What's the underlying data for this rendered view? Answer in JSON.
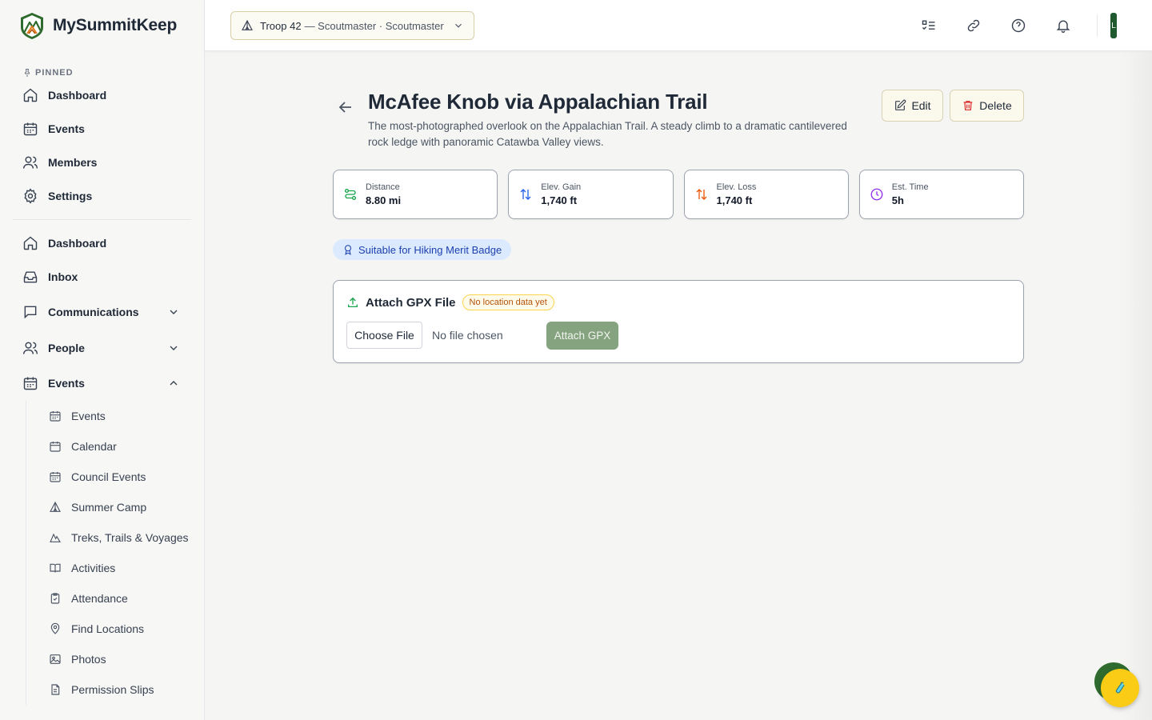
{
  "brand": {
    "name": "MySummitKeep"
  },
  "sidebar": {
    "pinned_label": "PINNED",
    "pinned": [
      {
        "label": "Dashboard",
        "icon": "home-icon"
      },
      {
        "label": "Events",
        "icon": "calendar-icon"
      },
      {
        "label": "Members",
        "icon": "users-icon"
      },
      {
        "label": "Settings",
        "icon": "gear-icon"
      }
    ],
    "main": [
      {
        "label": "Dashboard",
        "icon": "home-icon"
      },
      {
        "label": "Inbox",
        "icon": "inbox-icon"
      },
      {
        "label": "Communications",
        "icon": "chat-icon",
        "expanded": false
      },
      {
        "label": "People",
        "icon": "users-icon",
        "expanded": false
      },
      {
        "label": "Events",
        "icon": "calendar-icon",
        "expanded": true
      }
    ],
    "events_sub": [
      {
        "label": "Events",
        "icon": "calendar-icon"
      },
      {
        "label": "Calendar",
        "icon": "calendar-icon"
      },
      {
        "label": "Council Events",
        "icon": "calendar-icon"
      },
      {
        "label": "Summer Camp",
        "icon": "tent-icon"
      },
      {
        "label": "Treks, Trails & Voyages",
        "icon": "mountain-icon"
      },
      {
        "label": "Activities",
        "icon": "book-icon"
      },
      {
        "label": "Attendance",
        "icon": "clipboard-icon"
      },
      {
        "label": "Find Locations",
        "icon": "map-pin-icon"
      },
      {
        "label": "Photos",
        "icon": "image-icon"
      },
      {
        "label": "Permission Slips",
        "icon": "document-icon"
      }
    ]
  },
  "topbar": {
    "troop_name": "Troop 42",
    "troop_role": "— Scoutmaster · Scoutmaster",
    "avatar_initial": "L"
  },
  "trail": {
    "title": "McAfee Knob via Appalachian Trail",
    "description": "The most-photographed overlook on the Appalachian Trail. A steady climb to a dramatic cantilevered rock ledge with panoramic Catawba Valley views.",
    "edit_label": "Edit",
    "delete_label": "Delete",
    "stats": [
      {
        "label": "Distance",
        "value": "8.80 mi",
        "icon": "route-icon",
        "color": "#16a34a"
      },
      {
        "label": "Elev. Gain",
        "value": "1,740 ft",
        "icon": "arrows-up-down-icon",
        "color": "#2563eb"
      },
      {
        "label": "Elev. Loss",
        "value": "1,740 ft",
        "icon": "arrows-up-down-icon",
        "color": "#ea580c"
      },
      {
        "label": "Est. Time",
        "value": "5h",
        "icon": "clock-icon",
        "color": "#9333ea"
      }
    ],
    "badge": "Suitable for Hiking Merit Badge"
  },
  "gpx": {
    "title": "Attach GPX File",
    "status_pill": "No location data yet",
    "choose_label": "Choose File",
    "file_status": "No file chosen",
    "attach_label": "Attach GPX"
  },
  "colors": {
    "accent_green": "#2f6b2f",
    "fab_yellow": "#facc15",
    "attach_button": "#86a380"
  }
}
